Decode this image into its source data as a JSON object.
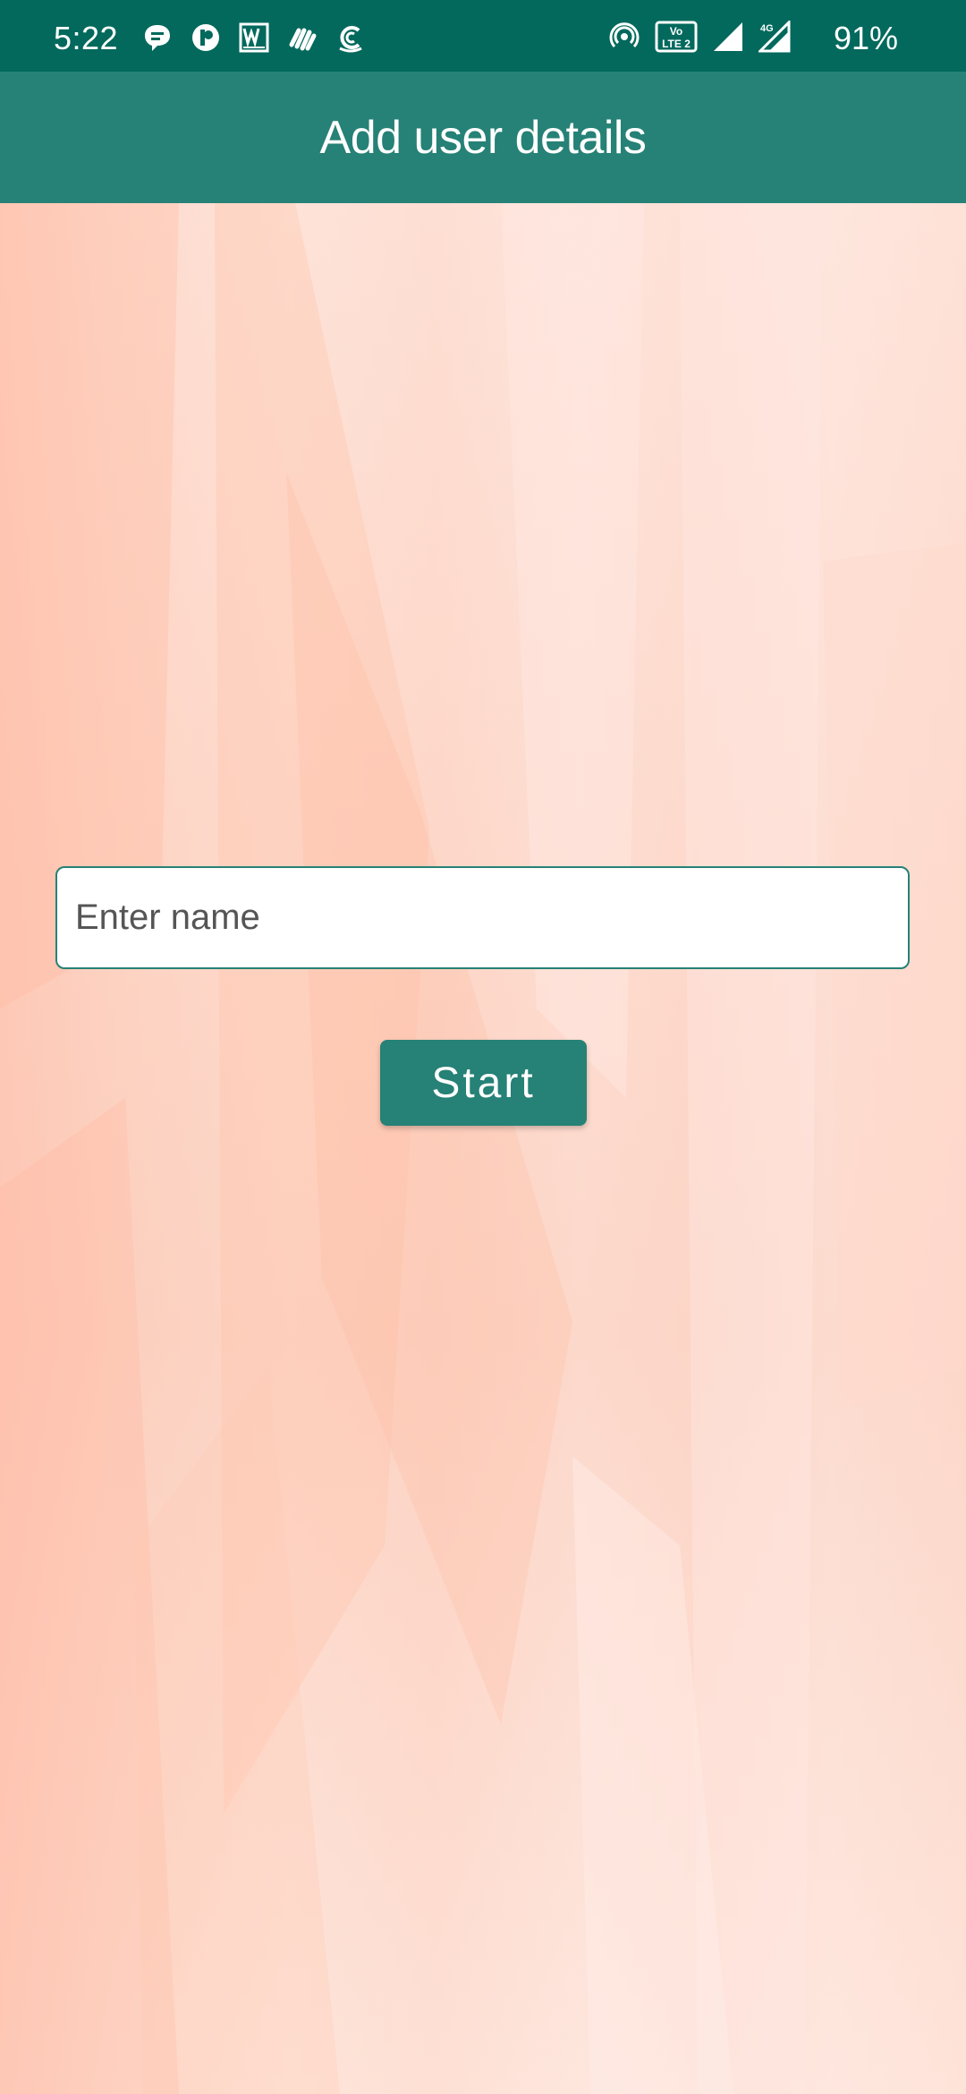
{
  "status_bar": {
    "time": "5:22",
    "battery": "91%",
    "left_icons": [
      "chat-bubble-icon",
      "app-icon",
      "word-icon",
      "hands-icon",
      "c-app-icon"
    ],
    "right_icons": [
      "hotspot-icon",
      "volte-icon",
      "signal-icon",
      "signal-4g-icon"
    ],
    "volte_label": "LTE 2",
    "network_label": "4G"
  },
  "app_bar": {
    "title": "Add user details"
  },
  "form": {
    "name_input": {
      "placeholder": "Enter name",
      "value": ""
    },
    "start_label": "Start"
  },
  "colors": {
    "status_bar": "#02695c",
    "app_bar": "#268176",
    "accent": "#268176",
    "background": "#fbdcd0"
  }
}
